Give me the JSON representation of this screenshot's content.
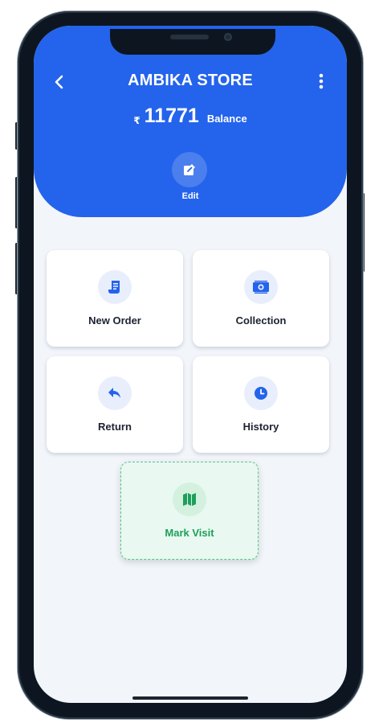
{
  "header": {
    "title": "AMBIKA STORE",
    "currency_symbol": "₹",
    "balance_amount": "11771",
    "balance_label": "Balance",
    "edit_label": "Edit"
  },
  "actions": [
    {
      "label": "New Order",
      "icon": "receipt-icon"
    },
    {
      "label": "Collection",
      "icon": "money-icon"
    },
    {
      "label": "Return",
      "icon": "reply-icon"
    },
    {
      "label": "History",
      "icon": "clock-icon"
    },
    {
      "label": "Mark Visit",
      "icon": "map-icon"
    }
  ],
  "colors": {
    "primary": "#2463eb",
    "background": "#f2f5fa",
    "card": "#ffffff",
    "visit_accent": "#1e9e5a",
    "visit_background": "#e9f8f0"
  }
}
